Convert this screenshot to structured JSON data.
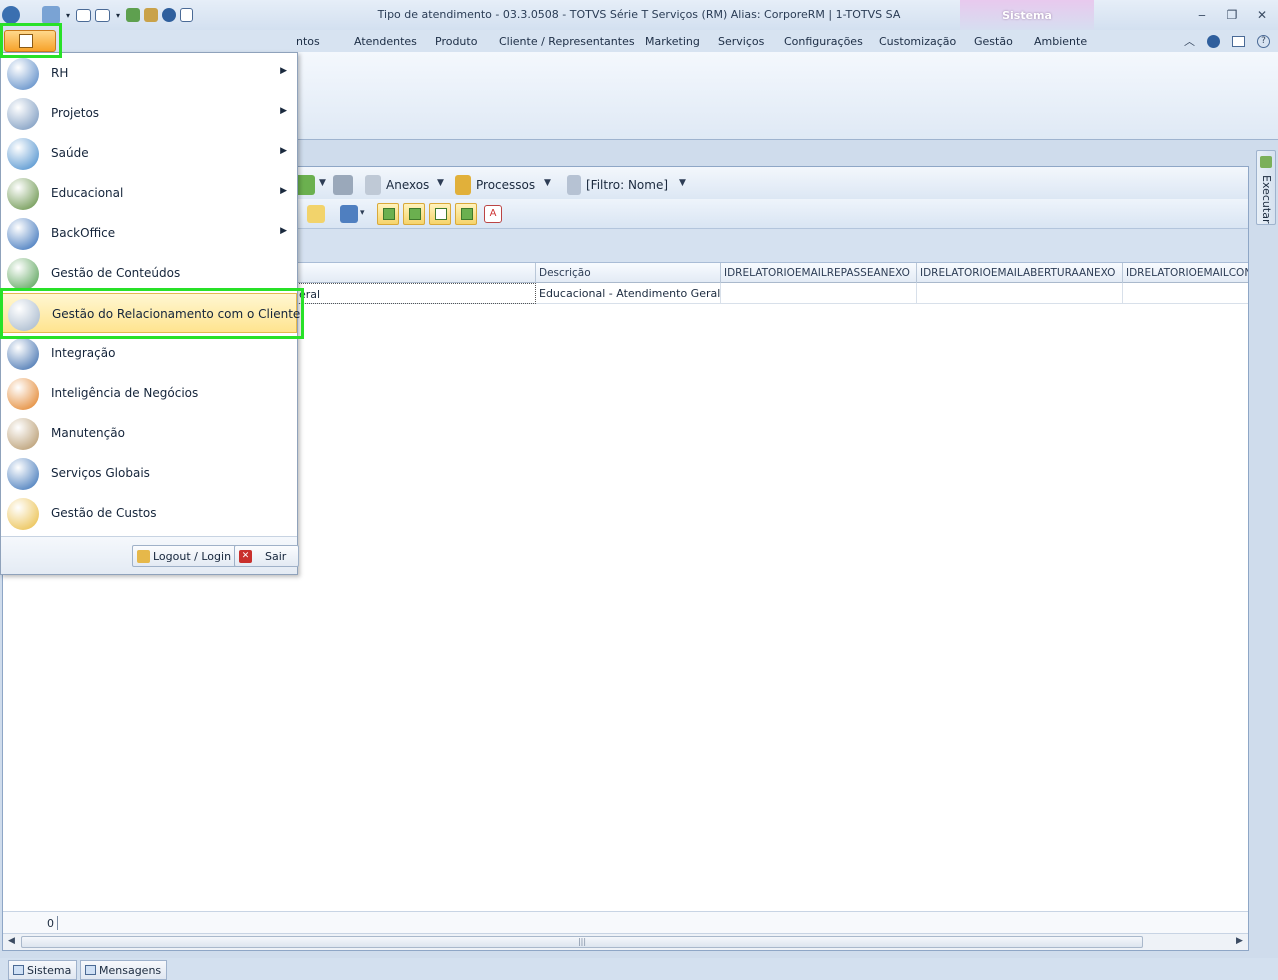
{
  "window": {
    "title": "Tipo de atendimento - 03.3.0508 - TOTVS Série T Serviços (RM) Alias: CorporeRM | 1-TOTVS SA",
    "context_tab": "Sistema"
  },
  "ribbon_tabs": [
    "ntos",
    "Atendentes",
    "Produto",
    "Cliente / Representantes",
    "Marketing",
    "Serviços",
    "Configurações",
    "Customização",
    "Gestão",
    "Ambiente"
  ],
  "toolbar": {
    "anexos": "Anexos",
    "processos": "Processos",
    "filtro": "[Filtro: Nome]"
  },
  "grid": {
    "headers": [
      "Descrição",
      "IDRELATORIOEMAILREPASSEANEXO",
      "IDRELATORIOEMAILABERTURAANEXO",
      "IDRELATORIOEMAILCON"
    ],
    "row": {
      "nome_partial": "eral",
      "descricao": "Educacional - Atendimento Geral"
    },
    "count": "0"
  },
  "side_tab": "Executar",
  "statusbar": {
    "sistema": "Sistema",
    "mensagens": "Mensagens"
  },
  "app_menu": {
    "items": [
      {
        "label": "RH",
        "icon": "rh-icon",
        "has_submenu": true
      },
      {
        "label": "Projetos",
        "icon": "projetos-icon",
        "has_submenu": true
      },
      {
        "label": "Saúde",
        "icon": "saude-caduceus-icon",
        "has_submenu": true
      },
      {
        "label": "Educacional",
        "icon": "educacional-chalkboard-icon",
        "has_submenu": true
      },
      {
        "label": "BackOffice",
        "icon": "dollar-icon",
        "has_submenu": true
      },
      {
        "label": "Gestão de Conteúdos",
        "icon": "globe-icon",
        "has_submenu": false
      },
      {
        "label": "Gestão do Relacionamento com o Cliente",
        "icon": "crm-satellite-icon",
        "has_submenu": false
      },
      {
        "label": "Integração",
        "icon": "integration-globe-icon",
        "has_submenu": false
      },
      {
        "label": "Inteligência de Negócios",
        "icon": "sigma-icon",
        "has_submenu": false
      },
      {
        "label": "Manutenção",
        "icon": "tools-icon",
        "has_submenu": false
      },
      {
        "label": "Serviços Globais",
        "icon": "global-services-icon",
        "has_submenu": false
      },
      {
        "label": "Gestão de Custos",
        "icon": "piggy-bank-icon",
        "has_submenu": false
      }
    ],
    "selected_index": 6,
    "logout_label": "Logout / Login",
    "exit_label": "Sair"
  },
  "colors": {
    "highlight_frame": "#28e128",
    "selected_item_bg": "#ffe48f",
    "ribbon_bg": "#dfe9f5"
  }
}
